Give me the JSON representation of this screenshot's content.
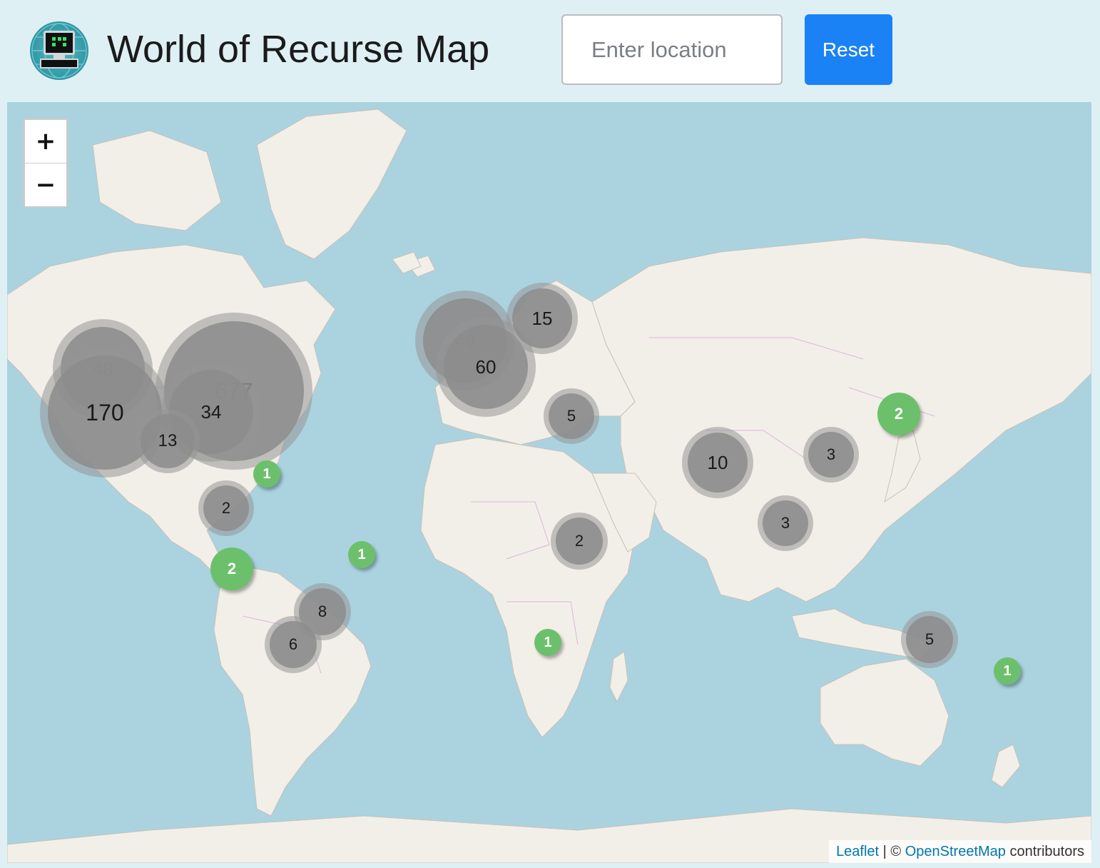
{
  "header": {
    "title": "World of Recurse Map",
    "search_placeholder": "Enter location",
    "reset_label": "Reset"
  },
  "map": {
    "zoom_in": "+",
    "zoom_out": "−",
    "attribution": {
      "leaflet": "Leaflet",
      "separator": " | © ",
      "osm": "OpenStreetMap",
      "suffix": " contributors"
    },
    "clusters": [
      {
        "label": "48",
        "region": "pacific-northwest"
      },
      {
        "label": "677",
        "region": "eastern-us"
      },
      {
        "label": "170",
        "region": "california"
      },
      {
        "label": "34",
        "region": "central-us"
      },
      {
        "label": "13",
        "region": "mexico"
      },
      {
        "label": "49",
        "region": "british-isles"
      },
      {
        "label": "60",
        "region": "western-europe"
      },
      {
        "label": "15",
        "region": "scandinavia"
      },
      {
        "label": "5",
        "region": "eastern-mediterranean"
      },
      {
        "label": "10",
        "region": "india"
      },
      {
        "label": "3",
        "region": "china"
      },
      {
        "label": "3",
        "region": "southeast-asia"
      },
      {
        "label": "2",
        "region": "east-africa"
      },
      {
        "label": "2",
        "region": "colombia"
      },
      {
        "label": "8",
        "region": "southern-brazil"
      },
      {
        "label": "6",
        "region": "argentina"
      },
      {
        "label": "5",
        "region": "australia"
      }
    ],
    "markers": [
      {
        "label": "1",
        "region": "caribbean"
      },
      {
        "label": "2",
        "region": "peru"
      },
      {
        "label": "1",
        "region": "brazil-northeast"
      },
      {
        "label": "1",
        "region": "south-africa"
      },
      {
        "label": "2",
        "region": "japan"
      },
      {
        "label": "1",
        "region": "new-zealand"
      }
    ]
  },
  "colors": {
    "water": "#aad3df",
    "land": "#f2efe9",
    "cluster_grey": "#8c8c8c",
    "marker_green": "#6cc06b",
    "reset_blue": "#1b82f5",
    "header_bg": "#dff0f5"
  }
}
